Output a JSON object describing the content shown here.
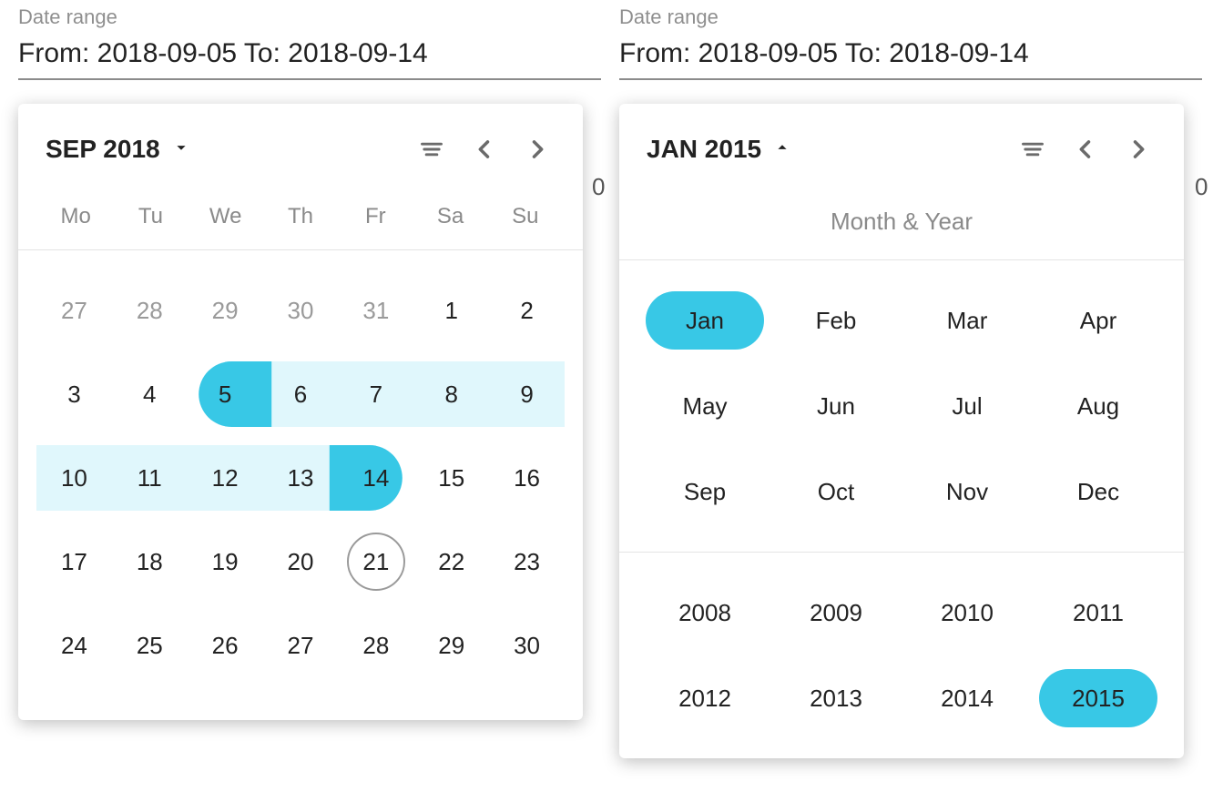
{
  "left": {
    "field_label": "Date range",
    "field_value": "From: 2018-09-05 To: 2018-09-14",
    "title": "SEP 2018",
    "dow": [
      "Mo",
      "Tu",
      "We",
      "Th",
      "Fr",
      "Sa",
      "Su"
    ],
    "weeks": [
      [
        {
          "n": "27",
          "other": true
        },
        {
          "n": "28",
          "other": true
        },
        {
          "n": "29",
          "other": true
        },
        {
          "n": "30",
          "other": true
        },
        {
          "n": "31",
          "other": true
        },
        {
          "n": "1"
        },
        {
          "n": "2"
        }
      ],
      [
        {
          "n": "3"
        },
        {
          "n": "4"
        },
        {
          "n": "5",
          "range": true,
          "cap": "start"
        },
        {
          "n": "6",
          "range": true
        },
        {
          "n": "7",
          "range": true
        },
        {
          "n": "8",
          "range": true
        },
        {
          "n": "9",
          "range": true
        }
      ],
      [
        {
          "n": "10",
          "range": true
        },
        {
          "n": "11",
          "range": true
        },
        {
          "n": "12",
          "range": true
        },
        {
          "n": "13",
          "range": true
        },
        {
          "n": "14",
          "range": true,
          "cap": "end"
        },
        {
          "n": "15"
        },
        {
          "n": "16"
        }
      ],
      [
        {
          "n": "17"
        },
        {
          "n": "18"
        },
        {
          "n": "19"
        },
        {
          "n": "20"
        },
        {
          "n": "21",
          "today": true
        },
        {
          "n": "22"
        },
        {
          "n": "23"
        }
      ],
      [
        {
          "n": "24"
        },
        {
          "n": "25"
        },
        {
          "n": "26"
        },
        {
          "n": "27"
        },
        {
          "n": "28"
        },
        {
          "n": "29"
        },
        {
          "n": "30"
        }
      ]
    ]
  },
  "right": {
    "field_label": "Date range",
    "field_value": "From: 2018-09-05 To: 2018-09-14",
    "title": "JAN 2015",
    "section_label": "Month & Year",
    "months": [
      "Jan",
      "Feb",
      "Mar",
      "Apr",
      "May",
      "Jun",
      "Jul",
      "Aug",
      "Sep",
      "Oct",
      "Nov",
      "Dec"
    ],
    "selected_month": "Jan",
    "years": [
      "2008",
      "2009",
      "2010",
      "2011",
      "2012",
      "2013",
      "2014",
      "2015"
    ],
    "selected_year": "2015"
  },
  "edge_left": "0",
  "edge_right": "0"
}
